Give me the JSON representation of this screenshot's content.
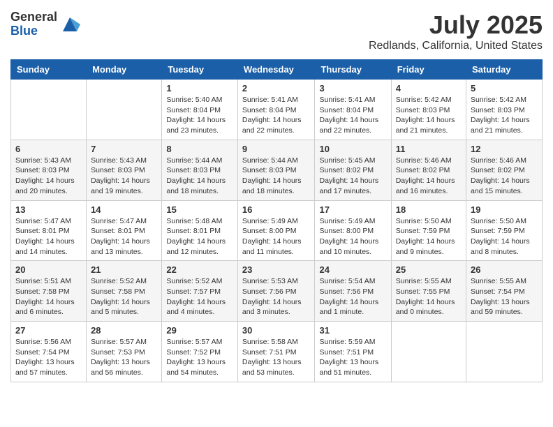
{
  "logo": {
    "general": "General",
    "blue": "Blue"
  },
  "header": {
    "month": "July 2025",
    "location": "Redlands, California, United States"
  },
  "weekdays": [
    "Sunday",
    "Monday",
    "Tuesday",
    "Wednesday",
    "Thursday",
    "Friday",
    "Saturday"
  ],
  "weeks": [
    [
      {
        "day": "",
        "info": ""
      },
      {
        "day": "",
        "info": ""
      },
      {
        "day": "1",
        "info": "Sunrise: 5:40 AM\nSunset: 8:04 PM\nDaylight: 14 hours and 23 minutes."
      },
      {
        "day": "2",
        "info": "Sunrise: 5:41 AM\nSunset: 8:04 PM\nDaylight: 14 hours and 22 minutes."
      },
      {
        "day": "3",
        "info": "Sunrise: 5:41 AM\nSunset: 8:04 PM\nDaylight: 14 hours and 22 minutes."
      },
      {
        "day": "4",
        "info": "Sunrise: 5:42 AM\nSunset: 8:03 PM\nDaylight: 14 hours and 21 minutes."
      },
      {
        "day": "5",
        "info": "Sunrise: 5:42 AM\nSunset: 8:03 PM\nDaylight: 14 hours and 21 minutes."
      }
    ],
    [
      {
        "day": "6",
        "info": "Sunrise: 5:43 AM\nSunset: 8:03 PM\nDaylight: 14 hours and 20 minutes."
      },
      {
        "day": "7",
        "info": "Sunrise: 5:43 AM\nSunset: 8:03 PM\nDaylight: 14 hours and 19 minutes."
      },
      {
        "day": "8",
        "info": "Sunrise: 5:44 AM\nSunset: 8:03 PM\nDaylight: 14 hours and 18 minutes."
      },
      {
        "day": "9",
        "info": "Sunrise: 5:44 AM\nSunset: 8:03 PM\nDaylight: 14 hours and 18 minutes."
      },
      {
        "day": "10",
        "info": "Sunrise: 5:45 AM\nSunset: 8:02 PM\nDaylight: 14 hours and 17 minutes."
      },
      {
        "day": "11",
        "info": "Sunrise: 5:46 AM\nSunset: 8:02 PM\nDaylight: 14 hours and 16 minutes."
      },
      {
        "day": "12",
        "info": "Sunrise: 5:46 AM\nSunset: 8:02 PM\nDaylight: 14 hours and 15 minutes."
      }
    ],
    [
      {
        "day": "13",
        "info": "Sunrise: 5:47 AM\nSunset: 8:01 PM\nDaylight: 14 hours and 14 minutes."
      },
      {
        "day": "14",
        "info": "Sunrise: 5:47 AM\nSunset: 8:01 PM\nDaylight: 14 hours and 13 minutes."
      },
      {
        "day": "15",
        "info": "Sunrise: 5:48 AM\nSunset: 8:01 PM\nDaylight: 14 hours and 12 minutes."
      },
      {
        "day": "16",
        "info": "Sunrise: 5:49 AM\nSunset: 8:00 PM\nDaylight: 14 hours and 11 minutes."
      },
      {
        "day": "17",
        "info": "Sunrise: 5:49 AM\nSunset: 8:00 PM\nDaylight: 14 hours and 10 minutes."
      },
      {
        "day": "18",
        "info": "Sunrise: 5:50 AM\nSunset: 7:59 PM\nDaylight: 14 hours and 9 minutes."
      },
      {
        "day": "19",
        "info": "Sunrise: 5:50 AM\nSunset: 7:59 PM\nDaylight: 14 hours and 8 minutes."
      }
    ],
    [
      {
        "day": "20",
        "info": "Sunrise: 5:51 AM\nSunset: 7:58 PM\nDaylight: 14 hours and 6 minutes."
      },
      {
        "day": "21",
        "info": "Sunrise: 5:52 AM\nSunset: 7:58 PM\nDaylight: 14 hours and 5 minutes."
      },
      {
        "day": "22",
        "info": "Sunrise: 5:52 AM\nSunset: 7:57 PM\nDaylight: 14 hours and 4 minutes."
      },
      {
        "day": "23",
        "info": "Sunrise: 5:53 AM\nSunset: 7:56 PM\nDaylight: 14 hours and 3 minutes."
      },
      {
        "day": "24",
        "info": "Sunrise: 5:54 AM\nSunset: 7:56 PM\nDaylight: 14 hours and 1 minute."
      },
      {
        "day": "25",
        "info": "Sunrise: 5:55 AM\nSunset: 7:55 PM\nDaylight: 14 hours and 0 minutes."
      },
      {
        "day": "26",
        "info": "Sunrise: 5:55 AM\nSunset: 7:54 PM\nDaylight: 13 hours and 59 minutes."
      }
    ],
    [
      {
        "day": "27",
        "info": "Sunrise: 5:56 AM\nSunset: 7:54 PM\nDaylight: 13 hours and 57 minutes."
      },
      {
        "day": "28",
        "info": "Sunrise: 5:57 AM\nSunset: 7:53 PM\nDaylight: 13 hours and 56 minutes."
      },
      {
        "day": "29",
        "info": "Sunrise: 5:57 AM\nSunset: 7:52 PM\nDaylight: 13 hours and 54 minutes."
      },
      {
        "day": "30",
        "info": "Sunrise: 5:58 AM\nSunset: 7:51 PM\nDaylight: 13 hours and 53 minutes."
      },
      {
        "day": "31",
        "info": "Sunrise: 5:59 AM\nSunset: 7:51 PM\nDaylight: 13 hours and 51 minutes."
      },
      {
        "day": "",
        "info": ""
      },
      {
        "day": "",
        "info": ""
      }
    ]
  ]
}
